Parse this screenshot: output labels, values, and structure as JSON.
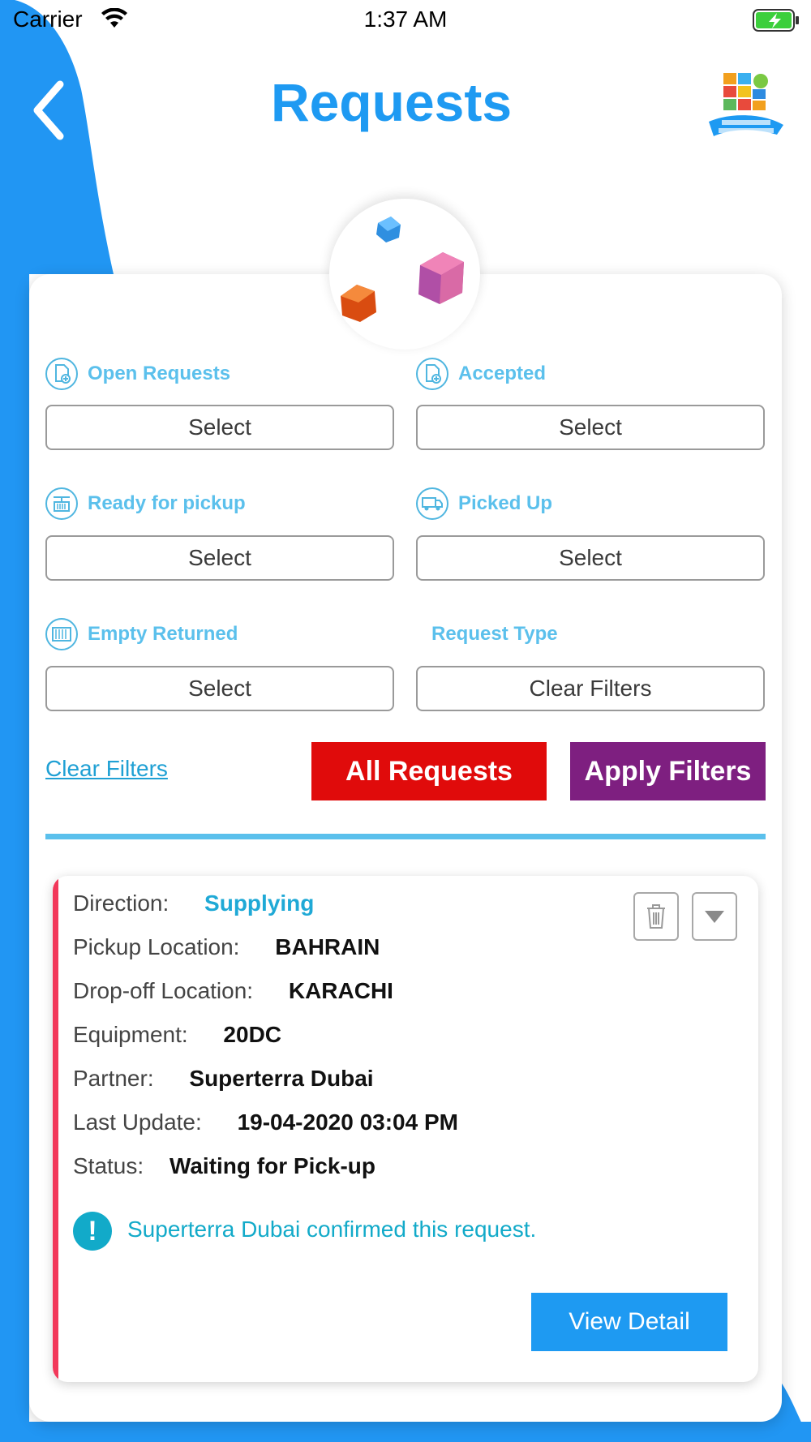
{
  "status_bar": {
    "carrier": "Carrier",
    "time": "1:37 AM"
  },
  "header": {
    "title": "Requests"
  },
  "filters": [
    {
      "label": "Open Requests",
      "value": "Select",
      "icon": "document-add-icon"
    },
    {
      "label": "Accepted",
      "value": "Select",
      "icon": "document-add-icon"
    },
    {
      "label": "Ready for pickup",
      "value": "Select",
      "icon": "container-crane-icon"
    },
    {
      "label": "Picked Up",
      "value": "Select",
      "icon": "truck-icon"
    },
    {
      "label": "Empty Returned",
      "value": "Select",
      "icon": "container-icon"
    },
    {
      "label": "Request Type",
      "value": "Clear Filters"
    }
  ],
  "actions": {
    "clear_filters": "Clear Filters",
    "all_requests": "All Requests",
    "apply_filters": "Apply Filters"
  },
  "request": {
    "direction_label": "Direction:",
    "direction": "Supplying",
    "pickup_label": "Pickup Location:",
    "pickup": "BAHRAIN",
    "dropoff_label": "Drop-off Location:",
    "dropoff": "KARACHI",
    "equipment_label": "Equipment:",
    "equipment": "20DC",
    "partner_label": "Partner:",
    "partner": "Superterra Dubai",
    "last_update_label": "Last Update:",
    "last_update": "19-04-2020 03:04 PM",
    "status_label": "Status:",
    "status": "Waiting for Pick-up",
    "notice": "Superterra Dubai confirmed this request.",
    "notice_icon": "!",
    "view_detail": "View Detail"
  },
  "colors": {
    "primary_blue": "#1e9af2",
    "label_blue": "#5bc0ec",
    "all_requests_red": "#e00b0b",
    "apply_purple": "#7e1f80",
    "accent_pink": "#f2385a"
  }
}
